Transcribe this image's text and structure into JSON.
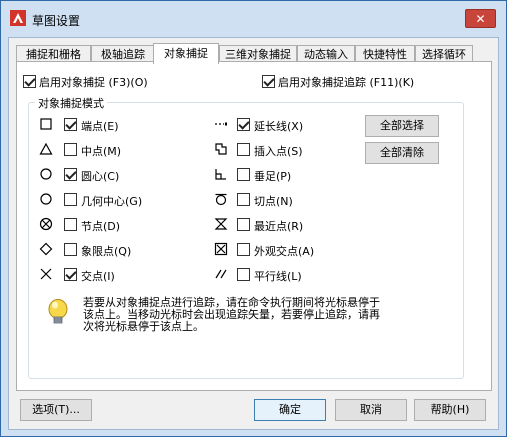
{
  "window": {
    "title": "草图设置",
    "close_symbol": "✕"
  },
  "tabs": [
    {
      "label": "捕捉和栅格",
      "active": false
    },
    {
      "label": "极轴追踪",
      "active": false
    },
    {
      "label": "对象捕捉",
      "active": true
    },
    {
      "label": "三维对象捕捉",
      "active": false
    },
    {
      "label": "动态输入",
      "active": false
    },
    {
      "label": "快捷特性",
      "active": false
    },
    {
      "label": "选择循环",
      "active": false
    }
  ],
  "top_options": {
    "enable_osnap": {
      "label": "启用对象捕捉 (F3)(O)",
      "checked": true
    },
    "enable_tracking": {
      "label": "启用对象捕捉追踪 (F11)(K)",
      "checked": true
    }
  },
  "modes_group": {
    "title": "对象捕捉模式"
  },
  "modes_left": [
    {
      "icon": "square-endpoint-icon",
      "label": "端点(E)",
      "checked": true
    },
    {
      "icon": "triangle-midpoint-icon",
      "label": "中点(M)",
      "checked": false
    },
    {
      "icon": "circle-center-icon",
      "label": "圆心(C)",
      "checked": true
    },
    {
      "icon": "circle-geometric-center-icon",
      "label": "几何中心(G)",
      "checked": false
    },
    {
      "icon": "node-icon",
      "label": "节点(D)",
      "checked": false
    },
    {
      "icon": "diamond-quadrant-icon",
      "label": "象限点(Q)",
      "checked": false
    },
    {
      "icon": "x-intersection-icon",
      "label": "交点(I)",
      "checked": true
    }
  ],
  "modes_right": [
    {
      "icon": "extension-icon",
      "label": "延长线(X)",
      "checked": true
    },
    {
      "icon": "insertion-icon",
      "label": "插入点(S)",
      "checked": false
    },
    {
      "icon": "perpendicular-icon",
      "label": "垂足(P)",
      "checked": false
    },
    {
      "icon": "tangent-icon",
      "label": "切点(N)",
      "checked": false
    },
    {
      "icon": "nearest-icon",
      "label": "最近点(R)",
      "checked": false
    },
    {
      "icon": "apparent-intersection-icon",
      "label": "外观交点(A)",
      "checked": false
    },
    {
      "icon": "parallel-icon",
      "label": "平行线(L)",
      "checked": false
    }
  ],
  "buttons": {
    "select_all": "全部选择",
    "clear_all": "全部清除",
    "options": "选项(T)...",
    "ok": "确定",
    "cancel": "取消",
    "help": "帮助(H)"
  },
  "info": {
    "icon": "lightbulb-icon",
    "line1": "若要从对象捕捉点进行追踪，请在命令执行期间将光标悬停于",
    "line2": "该点上。当移动光标时会出现追踪矢量，若要停止追踪，请再",
    "line3": "次将光标悬停于该点上。"
  },
  "colors": {
    "title_bg": "#cfe0f3",
    "close_bg": "#c7453a",
    "app_icon": "#d2342c"
  }
}
